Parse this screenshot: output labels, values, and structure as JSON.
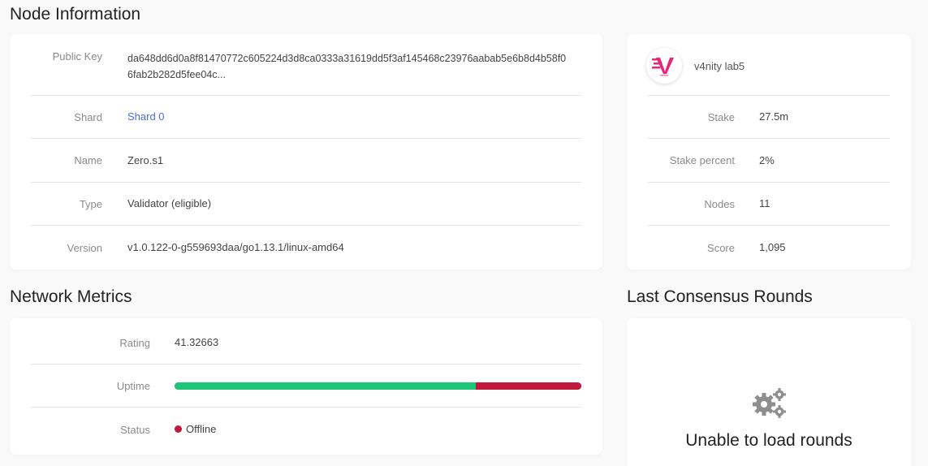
{
  "node_info": {
    "title": "Node Information",
    "public_key": {
      "label": "Public Key",
      "value_line1": "da648dd6d0a8f81470772c605224d3d8ca0333a31619dd5f3af145468c23976aabab5e6b8d4b58f0",
      "value_line2": "6fab2b282d5fee04c..."
    },
    "shard": {
      "label": "Shard",
      "value": "Shard 0"
    },
    "name": {
      "label": "Name",
      "value": "Zero.s1"
    },
    "type": {
      "label": "Type",
      "value": "Validator (eligible)"
    },
    "version": {
      "label": "Version",
      "value": "v1.0.122-0-g559693daa/go1.13.1/linux-amd64"
    }
  },
  "provider": {
    "name": "v4nity lab5",
    "logo_icon": "v4nity-logo-icon",
    "stake": {
      "label": "Stake",
      "value": "27.5m"
    },
    "stake_percent": {
      "label": "Stake percent",
      "value": "2%"
    },
    "nodes": {
      "label": "Nodes",
      "value": "11"
    },
    "score": {
      "label": "Score",
      "value": "1,095"
    }
  },
  "network_metrics": {
    "title": "Network Metrics",
    "rating": {
      "label": "Rating",
      "value": "41.32663"
    },
    "uptime": {
      "label": "Uptime",
      "up_fraction": 0.74,
      "up_color": "#1ec677",
      "down_color": "#c2183b"
    },
    "status": {
      "label": "Status",
      "value": "Offline",
      "color": "#c2183b"
    }
  },
  "consensus": {
    "title": "Last Consensus Rounds",
    "empty_icon": "gears-icon",
    "empty_message": "Unable to load rounds"
  }
}
